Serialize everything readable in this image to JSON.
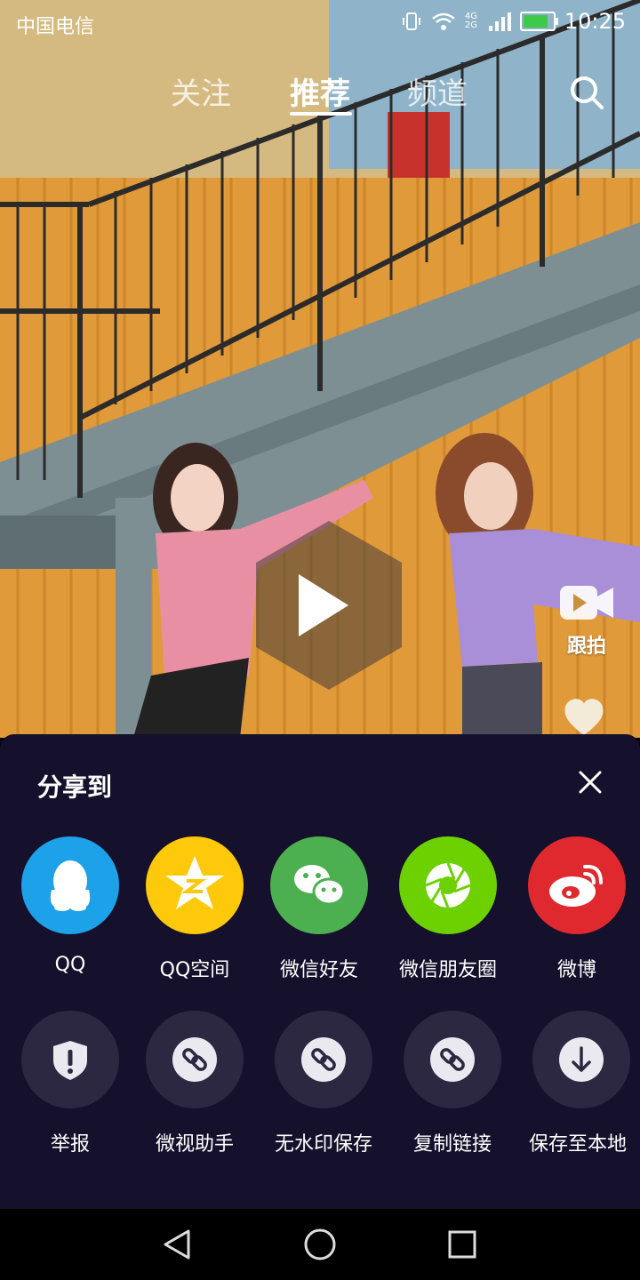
{
  "status_bar": {
    "carrier": "中国电信",
    "network": "4G 2G",
    "battery_level": 0.85,
    "time": "10:25"
  },
  "top_tabs": [
    {
      "label": "关注",
      "active": false
    },
    {
      "label": "推荐",
      "active": true
    },
    {
      "label": "频道",
      "active": false
    }
  ],
  "side_actions": {
    "follow_shoot_label": "跟拍",
    "follow_shoot_icon": "video-camera-icon",
    "like_icon": "heart-icon"
  },
  "share_sheet": {
    "title": "分享到",
    "close_icon": "close-icon",
    "targets": [
      {
        "label": "QQ",
        "icon": "qq-penguin-icon",
        "color": "#1da1e8"
      },
      {
        "label": "QQ空间",
        "icon": "qzone-star-icon",
        "color": "#fec80b"
      },
      {
        "label": "微信好友",
        "icon": "wechat-icon",
        "color": "#4caf50"
      },
      {
        "label": "微信朋友圈",
        "icon": "wechat-moments-icon",
        "color": "#6dd000"
      },
      {
        "label": "微博",
        "icon": "weibo-icon",
        "color": "#e0292f"
      }
    ],
    "actions": [
      {
        "label": "举报",
        "icon": "report-shield-icon"
      },
      {
        "label": "微视助手",
        "icon": "link-icon"
      },
      {
        "label": "无水印保存",
        "icon": "link-icon"
      },
      {
        "label": "复制链接",
        "icon": "link-icon"
      },
      {
        "label": "保存至本地",
        "icon": "download-icon"
      }
    ],
    "sheet_color": "#15102b",
    "action_circle_color": "#2d2841"
  },
  "nav_bar": {
    "back_icon": "back-triangle-icon",
    "home_icon": "home-circle-icon",
    "recents_icon": "recents-square-icon"
  }
}
